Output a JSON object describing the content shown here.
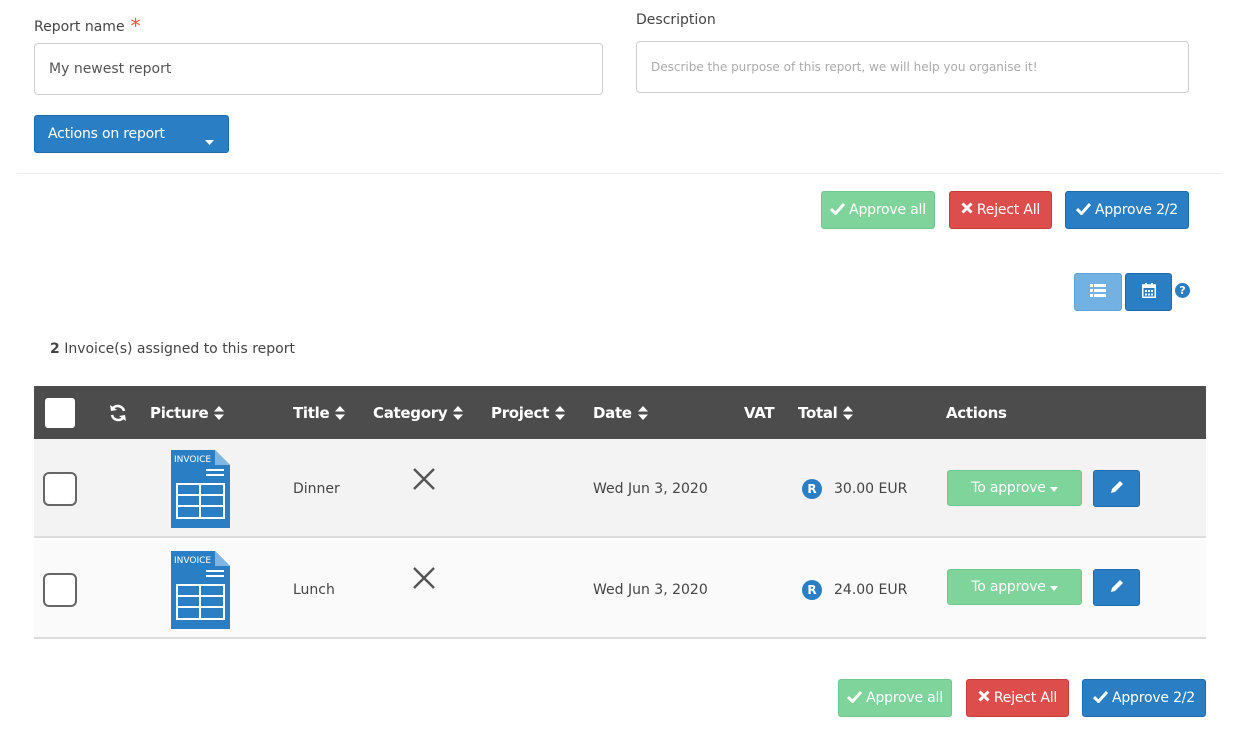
{
  "form": {
    "report_name_label": "Report name",
    "required_mark": "*",
    "report_name_value": "My newest report",
    "description_label": "Description",
    "description_placeholder": "Describe the purpose of this report, we will help you organise it!",
    "actions_button": "Actions on report"
  },
  "approval": {
    "approve_all": "Approve all",
    "reject_all": "Reject All",
    "approve_count": "Approve 2/2"
  },
  "summary": {
    "count": "2",
    "text": " Invoice(s) assigned to this report"
  },
  "table": {
    "columns": {
      "picture": "Picture",
      "title": "Title",
      "category": "Category",
      "project": "Project",
      "date": "Date",
      "vat": "VAT",
      "total": "Total",
      "actions": "Actions"
    },
    "rows": [
      {
        "thumb_label": "INVOICE",
        "title": "Dinner",
        "category_icon": "fork-knife-icon",
        "project": "",
        "date": "Wed Jun 3, 2020",
        "vat": "",
        "currency_badge": "R",
        "total": "30.00 EUR",
        "status": "To approve"
      },
      {
        "thumb_label": "INVOICE",
        "title": "Lunch",
        "category_icon": "fork-knife-icon",
        "project": "",
        "date": "Wed Jun 3, 2020",
        "vat": "",
        "currency_badge": "R",
        "total": "24.00 EUR",
        "status": "To approve"
      }
    ]
  },
  "colors": {
    "primary": "#2a7fc4",
    "success": "#7ed49a",
    "danger": "#dc4d4b",
    "header_bg": "#4c4c4c"
  }
}
